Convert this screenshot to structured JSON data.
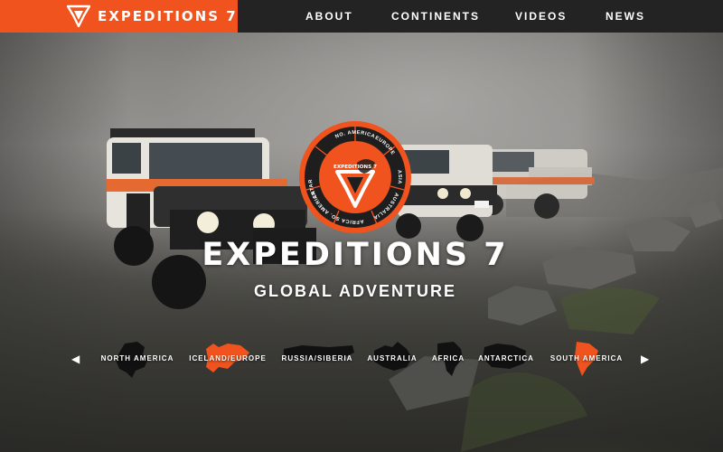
{
  "brand": {
    "name": "EXPEDITIONS 7"
  },
  "nav": [
    {
      "label": "ABOUT"
    },
    {
      "label": "CONTINENTS"
    },
    {
      "label": "VIDEOS"
    },
    {
      "label": "NEWS"
    }
  ],
  "emblem": {
    "ring_labels": [
      "NO. AMERICA",
      "EUROPE",
      "ASIA",
      "AUSTRALIA",
      "AFRICA",
      "SO. AMERICA",
      "ANTARCTICA"
    ],
    "center_text": "EXPEDITIONS 7"
  },
  "hero": {
    "title": "EXPEDITIONS 7",
    "subtitle": "GLOBAL ADVENTURE"
  },
  "carousel": {
    "prev_icon": "chevron-left-icon",
    "next_icon": "chevron-right-icon",
    "items": [
      {
        "label": "NORTH AMERICA",
        "highlight": false
      },
      {
        "label": "ICELAND/EUROPE",
        "highlight": true
      },
      {
        "label": "RUSSIA/SIBERIA",
        "highlight": false
      },
      {
        "label": "AUSTRALIA",
        "highlight": false
      },
      {
        "label": "AFRICA",
        "highlight": false
      },
      {
        "label": "ANTARCTICA",
        "highlight": false
      },
      {
        "label": "SOUTH AMERICA",
        "highlight": true
      }
    ]
  },
  "colors": {
    "accent": "#f0531d",
    "topbar": "#232323",
    "silhouette": "#111111"
  }
}
